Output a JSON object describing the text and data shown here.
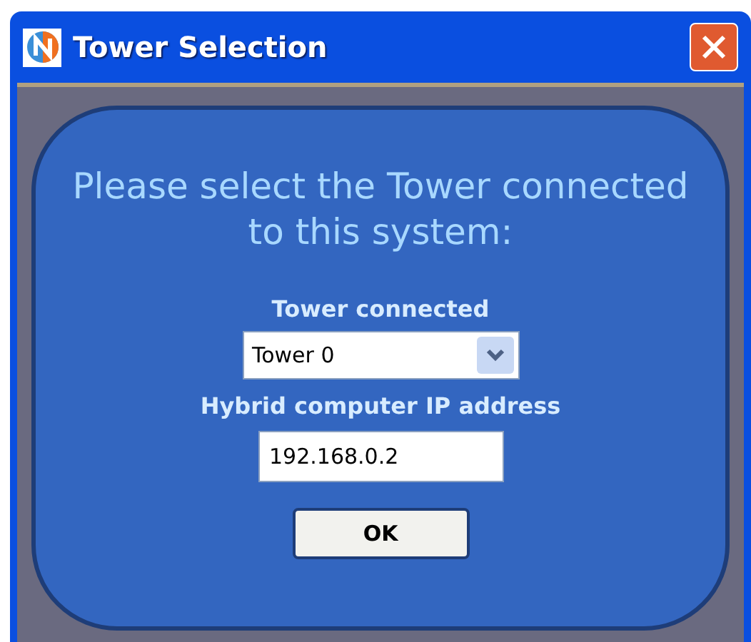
{
  "window": {
    "title": "Tower Selection"
  },
  "prompt": "Please select the Tower connected to this system:",
  "tower": {
    "label": "Tower connected",
    "value": "Tower 0"
  },
  "ip": {
    "label": "Hybrid computer IP address",
    "value": "192.168.0.2"
  },
  "buttons": [
    "OK"
  ]
}
